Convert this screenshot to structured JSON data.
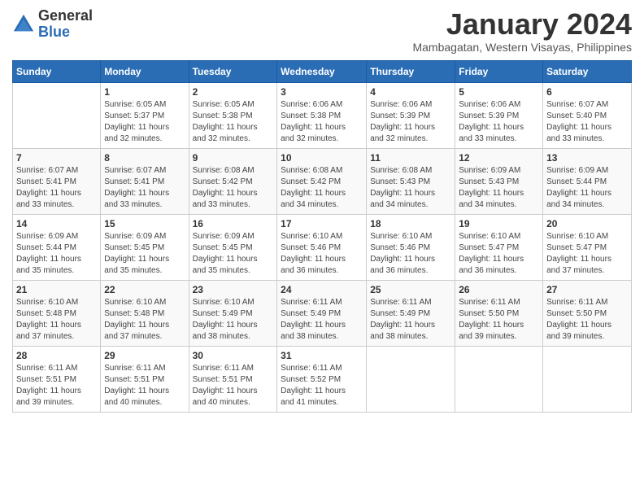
{
  "header": {
    "logo_general": "General",
    "logo_blue": "Blue",
    "month_title": "January 2024",
    "location": "Mambagatan, Western Visayas, Philippines"
  },
  "days_of_week": [
    "Sunday",
    "Monday",
    "Tuesday",
    "Wednesday",
    "Thursday",
    "Friday",
    "Saturday"
  ],
  "weeks": [
    [
      {
        "day": "",
        "info": ""
      },
      {
        "day": "1",
        "info": "Sunrise: 6:05 AM\nSunset: 5:37 PM\nDaylight: 11 hours\nand 32 minutes."
      },
      {
        "day": "2",
        "info": "Sunrise: 6:05 AM\nSunset: 5:38 PM\nDaylight: 11 hours\nand 32 minutes."
      },
      {
        "day": "3",
        "info": "Sunrise: 6:06 AM\nSunset: 5:38 PM\nDaylight: 11 hours\nand 32 minutes."
      },
      {
        "day": "4",
        "info": "Sunrise: 6:06 AM\nSunset: 5:39 PM\nDaylight: 11 hours\nand 32 minutes."
      },
      {
        "day": "5",
        "info": "Sunrise: 6:06 AM\nSunset: 5:39 PM\nDaylight: 11 hours\nand 33 minutes."
      },
      {
        "day": "6",
        "info": "Sunrise: 6:07 AM\nSunset: 5:40 PM\nDaylight: 11 hours\nand 33 minutes."
      }
    ],
    [
      {
        "day": "7",
        "info": "Sunrise: 6:07 AM\nSunset: 5:41 PM\nDaylight: 11 hours\nand 33 minutes."
      },
      {
        "day": "8",
        "info": "Sunrise: 6:07 AM\nSunset: 5:41 PM\nDaylight: 11 hours\nand 33 minutes."
      },
      {
        "day": "9",
        "info": "Sunrise: 6:08 AM\nSunset: 5:42 PM\nDaylight: 11 hours\nand 33 minutes."
      },
      {
        "day": "10",
        "info": "Sunrise: 6:08 AM\nSunset: 5:42 PM\nDaylight: 11 hours\nand 34 minutes."
      },
      {
        "day": "11",
        "info": "Sunrise: 6:08 AM\nSunset: 5:43 PM\nDaylight: 11 hours\nand 34 minutes."
      },
      {
        "day": "12",
        "info": "Sunrise: 6:09 AM\nSunset: 5:43 PM\nDaylight: 11 hours\nand 34 minutes."
      },
      {
        "day": "13",
        "info": "Sunrise: 6:09 AM\nSunset: 5:44 PM\nDaylight: 11 hours\nand 34 minutes."
      }
    ],
    [
      {
        "day": "14",
        "info": "Sunrise: 6:09 AM\nSunset: 5:44 PM\nDaylight: 11 hours\nand 35 minutes."
      },
      {
        "day": "15",
        "info": "Sunrise: 6:09 AM\nSunset: 5:45 PM\nDaylight: 11 hours\nand 35 minutes."
      },
      {
        "day": "16",
        "info": "Sunrise: 6:09 AM\nSunset: 5:45 PM\nDaylight: 11 hours\nand 35 minutes."
      },
      {
        "day": "17",
        "info": "Sunrise: 6:10 AM\nSunset: 5:46 PM\nDaylight: 11 hours\nand 36 minutes."
      },
      {
        "day": "18",
        "info": "Sunrise: 6:10 AM\nSunset: 5:46 PM\nDaylight: 11 hours\nand 36 minutes."
      },
      {
        "day": "19",
        "info": "Sunrise: 6:10 AM\nSunset: 5:47 PM\nDaylight: 11 hours\nand 36 minutes."
      },
      {
        "day": "20",
        "info": "Sunrise: 6:10 AM\nSunset: 5:47 PM\nDaylight: 11 hours\nand 37 minutes."
      }
    ],
    [
      {
        "day": "21",
        "info": "Sunrise: 6:10 AM\nSunset: 5:48 PM\nDaylight: 11 hours\nand 37 minutes."
      },
      {
        "day": "22",
        "info": "Sunrise: 6:10 AM\nSunset: 5:48 PM\nDaylight: 11 hours\nand 37 minutes."
      },
      {
        "day": "23",
        "info": "Sunrise: 6:10 AM\nSunset: 5:49 PM\nDaylight: 11 hours\nand 38 minutes."
      },
      {
        "day": "24",
        "info": "Sunrise: 6:11 AM\nSunset: 5:49 PM\nDaylight: 11 hours\nand 38 minutes."
      },
      {
        "day": "25",
        "info": "Sunrise: 6:11 AM\nSunset: 5:49 PM\nDaylight: 11 hours\nand 38 minutes."
      },
      {
        "day": "26",
        "info": "Sunrise: 6:11 AM\nSunset: 5:50 PM\nDaylight: 11 hours\nand 39 minutes."
      },
      {
        "day": "27",
        "info": "Sunrise: 6:11 AM\nSunset: 5:50 PM\nDaylight: 11 hours\nand 39 minutes."
      }
    ],
    [
      {
        "day": "28",
        "info": "Sunrise: 6:11 AM\nSunset: 5:51 PM\nDaylight: 11 hours\nand 39 minutes."
      },
      {
        "day": "29",
        "info": "Sunrise: 6:11 AM\nSunset: 5:51 PM\nDaylight: 11 hours\nand 40 minutes."
      },
      {
        "day": "30",
        "info": "Sunrise: 6:11 AM\nSunset: 5:51 PM\nDaylight: 11 hours\nand 40 minutes."
      },
      {
        "day": "31",
        "info": "Sunrise: 6:11 AM\nSunset: 5:52 PM\nDaylight: 11 hours\nand 41 minutes."
      },
      {
        "day": "",
        "info": ""
      },
      {
        "day": "",
        "info": ""
      },
      {
        "day": "",
        "info": ""
      }
    ]
  ]
}
